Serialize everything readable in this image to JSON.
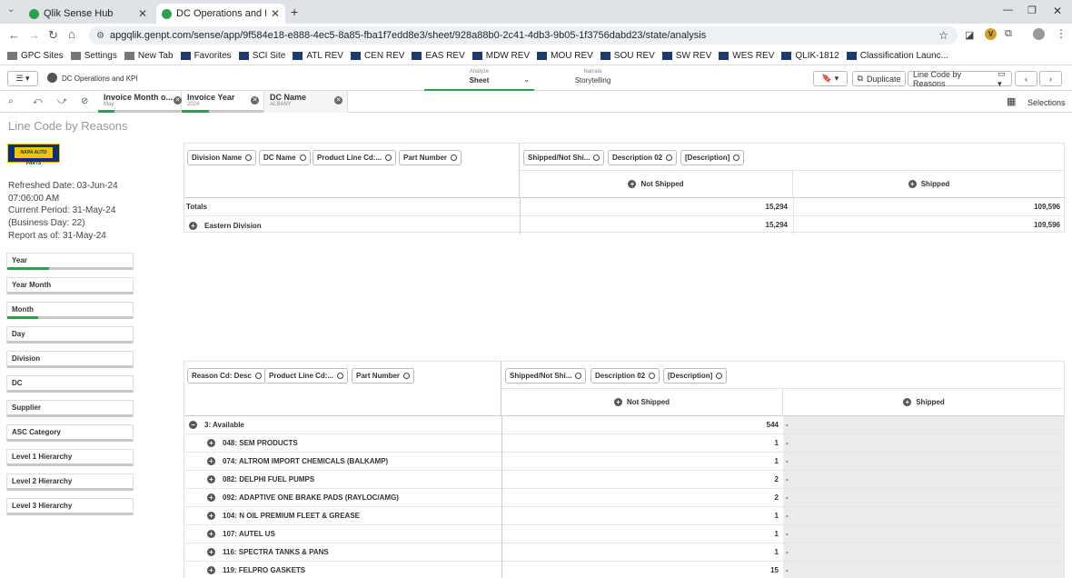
{
  "browser": {
    "tabs": [
      {
        "label": "Qlik Sense Hub"
      },
      {
        "label": "DC Operations and KPI - Line C"
      }
    ],
    "url": "apgqlik.genpt.com/sense/app/9f584e18-e888-4ec5-8a85-fba1f7edd8e3/sheet/928a88b0-2c41-4db3-9b05-1f3756dabd23/state/analysis",
    "bookmarks": [
      "GPC Sites",
      "Settings",
      "New Tab",
      "Favorites",
      "SCI Site",
      "ATL REV",
      "CEN REV",
      "EAS REV",
      "MDW REV",
      "MOU REV",
      "SOU REV",
      "SW REV",
      "WES REV",
      "QLIK-1812",
      "Classification Launc..."
    ]
  },
  "qlik": {
    "app_name": "DC Operations and KPI",
    "analyze_label": "Analyze",
    "sheet_label": "Sheet",
    "narrate_label": "Narrate",
    "storytelling_label": "Storytelling",
    "duplicate_label": "Duplicate",
    "sheet_selector": "Line Code by Reasons",
    "selections_label": "Selections",
    "chips": [
      {
        "title": "Invoice Month o...",
        "sub": "May"
      },
      {
        "title": "Invoice Year",
        "sub": "2024"
      },
      {
        "title": "DC Name",
        "sub": "ALBANY"
      }
    ]
  },
  "sheet": {
    "title": "Line Code by Reasons",
    "logo_text": "NAPA AUTO PARTS",
    "info": [
      "Refreshed Date: 03-Jun-24",
      "07:06:00 AM",
      "Current Period: 31-May-24",
      "(Business Day: 22)",
      "Report as of: 31-May-24"
    ],
    "filters": [
      "Year",
      "Year Month",
      "Month",
      "Day",
      "Division",
      "DC",
      "Supplier",
      "ASC Category",
      "Level 1 Hierarchy",
      "Level 2 Hierarchy",
      "Level 3 Hierarchy"
    ]
  },
  "table1": {
    "dims": [
      "Division Name",
      "DC Name",
      "Product Line Cd:...",
      "Part Number"
    ],
    "cols": [
      "Shipped/Not Shi...",
      "Description 02",
      "[Description]"
    ],
    "headers": [
      "Not Shipped",
      "Shipped"
    ],
    "rows": [
      {
        "label": "Totals",
        "not_shipped": "15,294",
        "shipped": "109,596"
      },
      {
        "label": "Eastern Division",
        "not_shipped": "15,294",
        "shipped": "109,596"
      }
    ]
  },
  "table2": {
    "dims": [
      "Reason Cd: Desc",
      "Product Line Cd:...",
      "Part Number"
    ],
    "cols": [
      "Shipped/Not Shi...",
      "Description 02",
      "[Description]"
    ],
    "headers": [
      "Not Shipped",
      "Shipped"
    ],
    "group": {
      "label": "3: Available",
      "not_shipped": "544",
      "shipped": "-"
    },
    "rows": [
      {
        "label": "048: SEM PRODUCTS",
        "not_shipped": "1",
        "shipped": "-"
      },
      {
        "label": "074: ALTROM IMPORT CHEMICALS (BALKAMP)",
        "not_shipped": "1",
        "shipped": "-"
      },
      {
        "label": "082: DELPHI FUEL PUMPS",
        "not_shipped": "2",
        "shipped": "-"
      },
      {
        "label": "092: ADAPTIVE ONE BRAKE PADS (RAYLOC/AMG)",
        "not_shipped": "2",
        "shipped": "-"
      },
      {
        "label": "104: N OIL PREMIUM FLEET & GREASE",
        "not_shipped": "1",
        "shipped": "-"
      },
      {
        "label": "107: AUTEL US",
        "not_shipped": "1",
        "shipped": "-"
      },
      {
        "label": "116: SPECTRA TANKS & PANS",
        "not_shipped": "1",
        "shipped": "-"
      },
      {
        "label": "119: FELPRO GASKETS",
        "not_shipped": "15",
        "shipped": "-"
      }
    ]
  }
}
